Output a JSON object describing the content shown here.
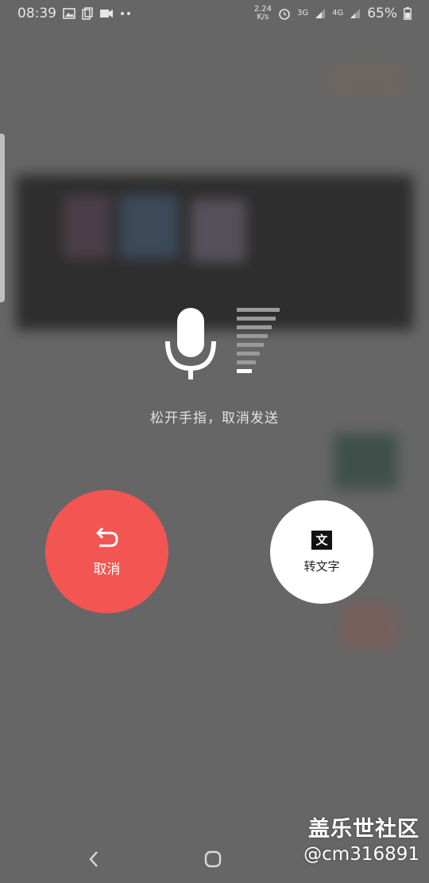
{
  "status_bar": {
    "time": "08:39",
    "speed_value": "2.24",
    "speed_unit": "K/s",
    "net_3g": "3G",
    "net_4g": "4G",
    "battery": "65%"
  },
  "recorder": {
    "hint": "松开手指，取消发送",
    "level_fraction": 0.12
  },
  "actions": {
    "cancel_label": "取消",
    "to_text_icon": "文",
    "to_text_label": "转文字"
  },
  "watermark": {
    "line1": "盖乐世社区",
    "line2": "@cm316891"
  },
  "icons": {
    "status_left": [
      "image-icon",
      "copy-icon",
      "video-icon",
      "more-dots-icon"
    ],
    "status_right": [
      "alarm-icon",
      "signal-icon",
      "battery-icon"
    ],
    "main": [
      "microphone-icon",
      "undo-arrow-icon"
    ],
    "nav": [
      "back-icon",
      "home-icon"
    ]
  },
  "colors": {
    "overlay_bg": "#666666",
    "cancel_red": "#f25552",
    "to_text_white": "#ffffff"
  }
}
